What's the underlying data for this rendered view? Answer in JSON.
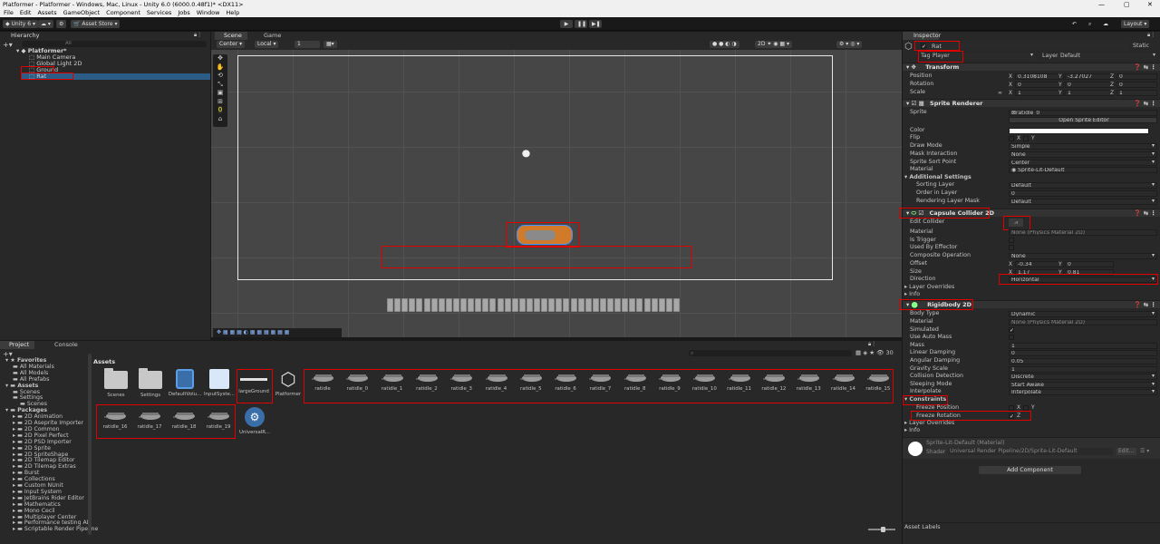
{
  "window": {
    "title": "Platformer - Platformer - Windows, Mac, Linux - Unity 6.0 (6000.0.48f1)* <DX11>"
  },
  "menu": [
    "File",
    "Edit",
    "Assets",
    "GameObject",
    "Component",
    "Services",
    "Jobs",
    "Window",
    "Help"
  ],
  "toolbar": {
    "account": "Unity 6",
    "asset_store": "Asset Store",
    "layout": "Layout"
  },
  "hierarchy": {
    "tab": "Hierarchy",
    "search_placeholder": "All",
    "scene": "Platformer*",
    "items": [
      "Main Camera",
      "Global Light 2D",
      "Ground",
      "Rat"
    ]
  },
  "scene": {
    "tabs": [
      "Scene",
      "Game"
    ],
    "pivot": "Center",
    "space": "Local",
    "grid_snap": "1",
    "tool_counter": "0"
  },
  "inspector": {
    "tab": "Inspector",
    "object_name": "Rat",
    "static_label": "Static",
    "tag_label": "Tag",
    "tag_value": "Player",
    "layer_label": "Layer",
    "layer_value": "Default",
    "transform": {
      "title": "Transform",
      "position_label": "Position",
      "position": {
        "x": "0.3108108",
        "y": "-3.27027",
        "z": "0"
      },
      "rotation_label": "Rotation",
      "rotation": {
        "x": "0",
        "y": "0",
        "z": "0"
      },
      "scale_label": "Scale",
      "scale": {
        "x": "1",
        "y": "1",
        "z": "1"
      }
    },
    "sprite_renderer": {
      "title": "Sprite Renderer",
      "sprite_label": "Sprite",
      "sprite": "ratidle_0",
      "open_editor": "Open Sprite Editor",
      "color_label": "Color",
      "flip_label": "Flip",
      "flip_x": "X",
      "flip_y": "Y",
      "draw_mode_label": "Draw Mode",
      "draw_mode": "Simple",
      "mask_label": "Mask Interaction",
      "mask": "None",
      "sort_point_label": "Sprite Sort Point",
      "sort_point": "Center",
      "material_label": "Material",
      "material": "Sprite-Lit-Default",
      "additional": "Additional Settings",
      "sorting_layer_label": "Sorting Layer",
      "sorting_layer": "Default",
      "order_label": "Order in Layer",
      "order": "0",
      "rendering_mask_label": "Rendering Layer Mask",
      "rendering_mask": "Default"
    },
    "capsule": {
      "title": "Capsule Collider 2D",
      "edit_label": "Edit Collider",
      "material_label": "Material",
      "material": "None (Physics Material 2D)",
      "trigger_label": "Is Trigger",
      "effector_label": "Used By Effector",
      "composite_label": "Composite Operation",
      "composite": "None",
      "offset_label": "Offset",
      "offset": {
        "x": "-0.34",
        "y": "0"
      },
      "size_label": "Size",
      "size": {
        "x": "1.17",
        "y": "0.81"
      },
      "direction_label": "Direction",
      "direction": "Horizontal",
      "layer_overrides": "Layer Overrides",
      "info": "Info"
    },
    "rigidbody": {
      "title": "Rigidbody 2D",
      "body_type_label": "Body Type",
      "body_type": "Dynamic",
      "material_label": "Material",
      "material": "None (Physics Material 2D)",
      "simulated_label": "Simulated",
      "auto_mass_label": "Use Auto Mass",
      "mass_label": "Mass",
      "mass": "1",
      "linear_label": "Linear Damping",
      "linear": "0",
      "angular_label": "Angular Damping",
      "angular": "0.05",
      "gravity_label": "Gravity Scale",
      "gravity": "1",
      "collision_label": "Collision Detection",
      "collision": "Discrete",
      "sleep_label": "Sleeping Mode",
      "sleep": "Start Awake",
      "interp_label": "Interpolate",
      "interp": "Interpolate",
      "constraints": "Constraints",
      "freeze_pos_label": "Freeze Position",
      "fp_x": "X",
      "fp_y": "Y",
      "freeze_rot_label": "Freeze Rotation",
      "fr_z": "Z",
      "layer_overrides": "Layer Overrides",
      "info": "Info"
    },
    "material_block": {
      "name": "Sprite-Lit-Default (Material)",
      "shader_label": "Shader",
      "shader": "Universal Render Pipeline/2D/Sprite-Lit-Default",
      "edit": "Edit..."
    },
    "add_component": "Add Component",
    "asset_labels": "Asset Labels"
  },
  "project": {
    "tabs": [
      "Project",
      "Console"
    ],
    "count": "30",
    "breadcrumb": "Assets",
    "tree": [
      "Favorites",
      "All Materials",
      "All Models",
      "All Prefabs",
      "Assets",
      "Scenes",
      "Settings",
      "Scenes",
      "Packages",
      "2D Animation",
      "2D Aseprite Importer",
      "2D Common",
      "2D Pixel Perfect",
      "2D PSD Importer",
      "2D Sprite",
      "2D SpriteShape",
      "2D Tilemap Editor",
      "2D Tilemap Extras",
      "Burst",
      "Collections",
      "Custom NUnit",
      "Input System",
      "JetBrains Rider Editor",
      "Mathematics",
      "Mono Cecil",
      "Multiplayer Center",
      "Performance testing API",
      "Scriptable Render Pipeline"
    ],
    "assets_row1": [
      "Scenes",
      "Settings",
      "DefaultVolu...",
      "InputSyste...",
      "largeGround",
      "Platformer",
      "ratidle",
      "ratidle_0",
      "ratidle_1",
      "ratidle_2",
      "ratidle_3",
      "ratidle_4",
      "ratidle_5",
      "ratidle_6",
      "ratidle_7",
      "ratidle_8",
      "ratidle_9",
      "ratidle_10",
      "ratidle_11",
      "ratidle_12",
      "ratidle_13",
      "ratidle_14",
      "ratidle_15"
    ],
    "assets_row2": [
      "ratidle_16",
      "ratidle_17",
      "ratidle_18",
      "ratidle_19",
      "UniversalR..."
    ]
  }
}
